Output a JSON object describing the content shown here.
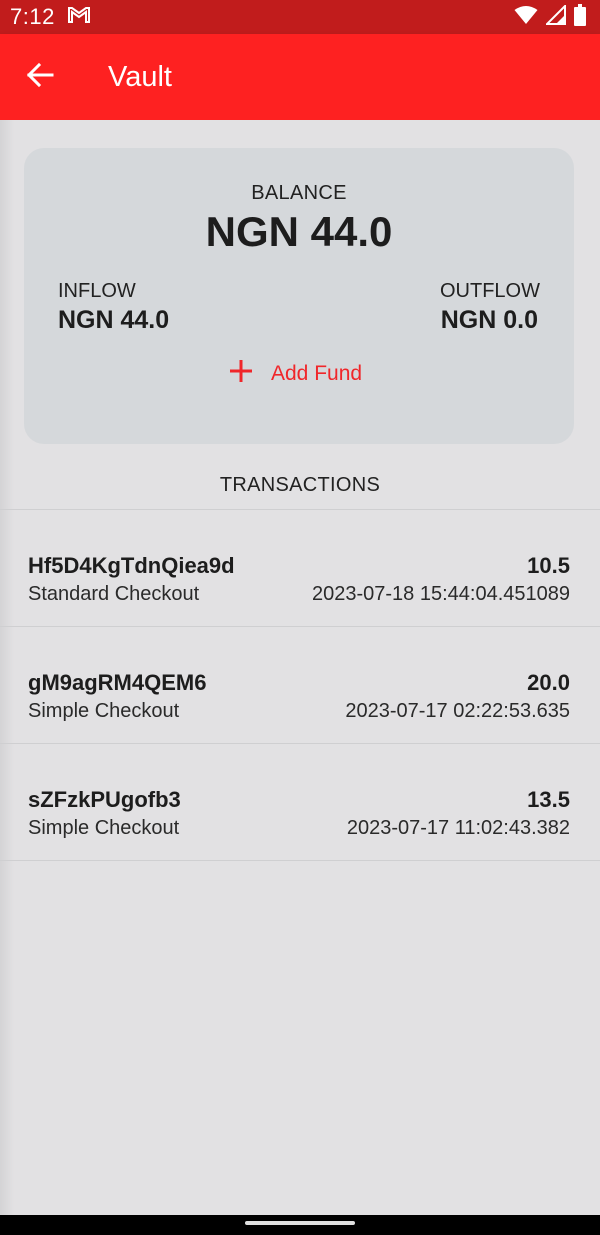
{
  "status_bar": {
    "time": "7:12",
    "icons": [
      "gmail-icon",
      "wifi-icon",
      "signal-icon",
      "battery-icon"
    ]
  },
  "app_bar": {
    "title": "Vault",
    "back_icon": "arrow-left-icon",
    "color": "#fe2121"
  },
  "summary": {
    "balance_label": "BALANCE",
    "balance_value": "NGN 44.0",
    "inflow_label": "INFLOW",
    "inflow_value": "NGN 44.0",
    "outflow_label": "OUTFLOW",
    "outflow_value": "NGN 0.0",
    "add_fund_label": "Add Fund",
    "add_fund_icon": "plus-icon",
    "accent_color": "#f0262a"
  },
  "transactions": {
    "header": "TRANSACTIONS",
    "items": [
      {
        "id": "Hf5D4KgTdnQiea9d",
        "type": "Standard Checkout",
        "amount": "10.5",
        "date": "2023-07-18 15:44:04.451089"
      },
      {
        "id": "gM9agRM4QEM6",
        "type": "Simple Checkout",
        "amount": "20.0",
        "date": "2023-07-17 02:22:53.635"
      },
      {
        "id": "sZFzkPUgofb3",
        "type": "Simple Checkout",
        "amount": "13.5",
        "date": "2023-07-17 11:02:43.382"
      }
    ]
  }
}
